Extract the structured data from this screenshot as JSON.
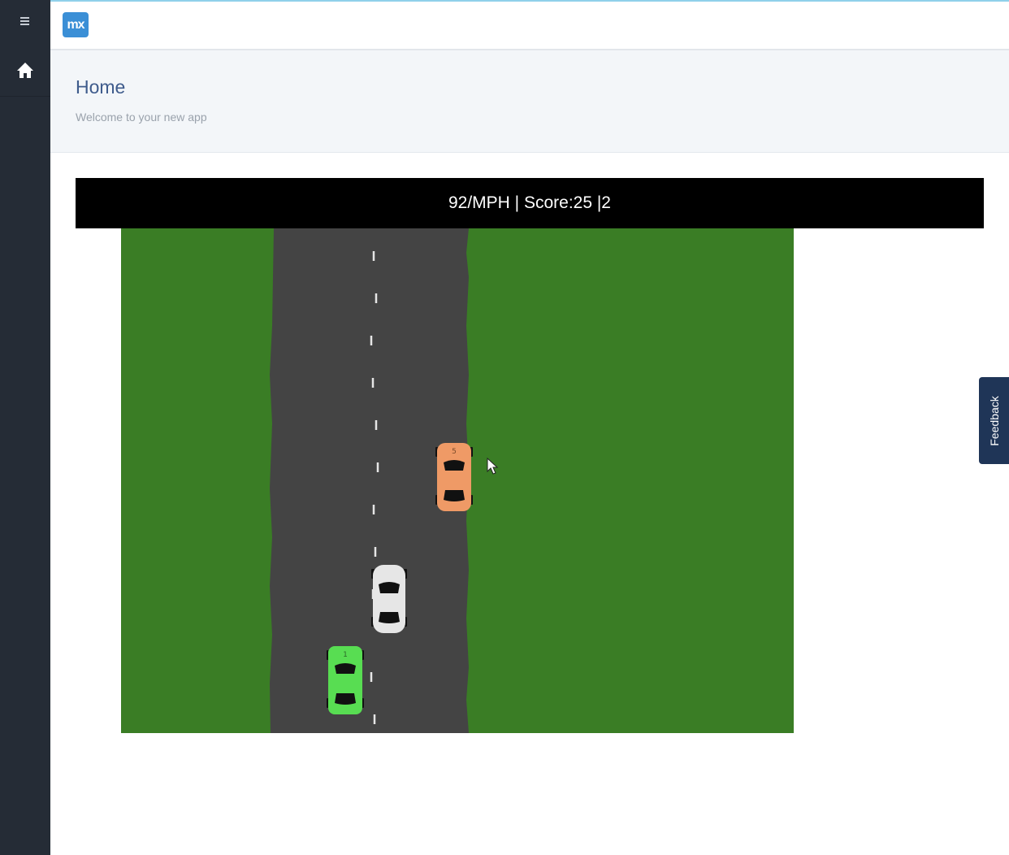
{
  "app": {
    "logo_text": "mx",
    "brand_color": "#3b8fd6",
    "sidebar_color": "#252c36"
  },
  "sidebar": {
    "items": [
      {
        "icon": "hamburger-icon"
      },
      {
        "icon": "home-icon"
      }
    ]
  },
  "header": {
    "title": "Home",
    "subtitle": "Welcome to your new app"
  },
  "game": {
    "hud": "92/MPH | Score:25 |2",
    "grass_color": "#3a7d25",
    "road_color": "#444444",
    "cars": [
      {
        "name": "orange-car",
        "color": "#ef9a66",
        "number": "5"
      },
      {
        "name": "white-car",
        "color": "#e6e6e6",
        "number": ""
      },
      {
        "name": "green-car",
        "color": "#58dd52",
        "number": "1"
      }
    ]
  },
  "feedback": {
    "label": "Feedback"
  }
}
